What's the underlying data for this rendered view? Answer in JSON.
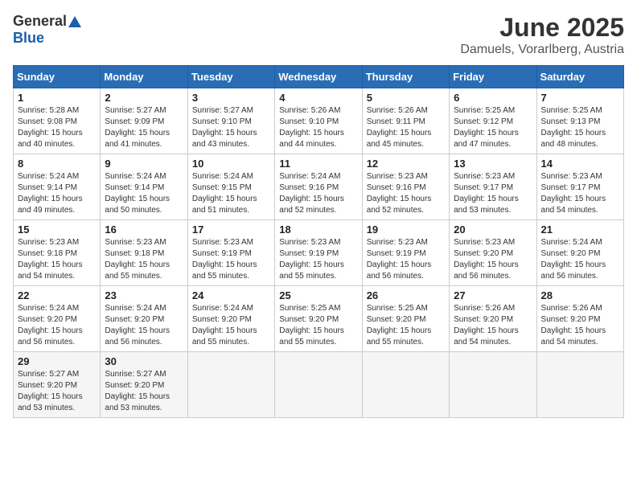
{
  "logo": {
    "general": "General",
    "blue": "Blue"
  },
  "title": {
    "month": "June 2025",
    "location": "Damuels, Vorarlberg, Austria"
  },
  "weekdays": [
    "Sunday",
    "Monday",
    "Tuesday",
    "Wednesday",
    "Thursday",
    "Friday",
    "Saturday"
  ],
  "weeks": [
    [
      {
        "day": 1,
        "sunrise": "5:28 AM",
        "sunset": "9:08 PM",
        "daylight": "15 hours and 40 minutes."
      },
      {
        "day": 2,
        "sunrise": "5:27 AM",
        "sunset": "9:09 PM",
        "daylight": "15 hours and 41 minutes."
      },
      {
        "day": 3,
        "sunrise": "5:27 AM",
        "sunset": "9:10 PM",
        "daylight": "15 hours and 43 minutes."
      },
      {
        "day": 4,
        "sunrise": "5:26 AM",
        "sunset": "9:10 PM",
        "daylight": "15 hours and 44 minutes."
      },
      {
        "day": 5,
        "sunrise": "5:26 AM",
        "sunset": "9:11 PM",
        "daylight": "15 hours and 45 minutes."
      },
      {
        "day": 6,
        "sunrise": "5:25 AM",
        "sunset": "9:12 PM",
        "daylight": "15 hours and 47 minutes."
      },
      {
        "day": 7,
        "sunrise": "5:25 AM",
        "sunset": "9:13 PM",
        "daylight": "15 hours and 48 minutes."
      }
    ],
    [
      {
        "day": 8,
        "sunrise": "5:24 AM",
        "sunset": "9:14 PM",
        "daylight": "15 hours and 49 minutes."
      },
      {
        "day": 9,
        "sunrise": "5:24 AM",
        "sunset": "9:14 PM",
        "daylight": "15 hours and 50 minutes."
      },
      {
        "day": 10,
        "sunrise": "5:24 AM",
        "sunset": "9:15 PM",
        "daylight": "15 hours and 51 minutes."
      },
      {
        "day": 11,
        "sunrise": "5:24 AM",
        "sunset": "9:16 PM",
        "daylight": "15 hours and 52 minutes."
      },
      {
        "day": 12,
        "sunrise": "5:23 AM",
        "sunset": "9:16 PM",
        "daylight": "15 hours and 52 minutes."
      },
      {
        "day": 13,
        "sunrise": "5:23 AM",
        "sunset": "9:17 PM",
        "daylight": "15 hours and 53 minutes."
      },
      {
        "day": 14,
        "sunrise": "5:23 AM",
        "sunset": "9:17 PM",
        "daylight": "15 hours and 54 minutes."
      }
    ],
    [
      {
        "day": 15,
        "sunrise": "5:23 AM",
        "sunset": "9:18 PM",
        "daylight": "15 hours and 54 minutes."
      },
      {
        "day": 16,
        "sunrise": "5:23 AM",
        "sunset": "9:18 PM",
        "daylight": "15 hours and 55 minutes."
      },
      {
        "day": 17,
        "sunrise": "5:23 AM",
        "sunset": "9:19 PM",
        "daylight": "15 hours and 55 minutes."
      },
      {
        "day": 18,
        "sunrise": "5:23 AM",
        "sunset": "9:19 PM",
        "daylight": "15 hours and 55 minutes."
      },
      {
        "day": 19,
        "sunrise": "5:23 AM",
        "sunset": "9:19 PM",
        "daylight": "15 hours and 56 minutes."
      },
      {
        "day": 20,
        "sunrise": "5:23 AM",
        "sunset": "9:20 PM",
        "daylight": "15 hours and 56 minutes."
      },
      {
        "day": 21,
        "sunrise": "5:24 AM",
        "sunset": "9:20 PM",
        "daylight": "15 hours and 56 minutes."
      }
    ],
    [
      {
        "day": 22,
        "sunrise": "5:24 AM",
        "sunset": "9:20 PM",
        "daylight": "15 hours and 56 minutes."
      },
      {
        "day": 23,
        "sunrise": "5:24 AM",
        "sunset": "9:20 PM",
        "daylight": "15 hours and 56 minutes."
      },
      {
        "day": 24,
        "sunrise": "5:24 AM",
        "sunset": "9:20 PM",
        "daylight": "15 hours and 55 minutes."
      },
      {
        "day": 25,
        "sunrise": "5:25 AM",
        "sunset": "9:20 PM",
        "daylight": "15 hours and 55 minutes."
      },
      {
        "day": 26,
        "sunrise": "5:25 AM",
        "sunset": "9:20 PM",
        "daylight": "15 hours and 55 minutes."
      },
      {
        "day": 27,
        "sunrise": "5:26 AM",
        "sunset": "9:20 PM",
        "daylight": "15 hours and 54 minutes."
      },
      {
        "day": 28,
        "sunrise": "5:26 AM",
        "sunset": "9:20 PM",
        "daylight": "15 hours and 54 minutes."
      }
    ],
    [
      {
        "day": 29,
        "sunrise": "5:27 AM",
        "sunset": "9:20 PM",
        "daylight": "15 hours and 53 minutes."
      },
      {
        "day": 30,
        "sunrise": "5:27 AM",
        "sunset": "9:20 PM",
        "daylight": "15 hours and 53 minutes."
      },
      null,
      null,
      null,
      null,
      null
    ]
  ]
}
